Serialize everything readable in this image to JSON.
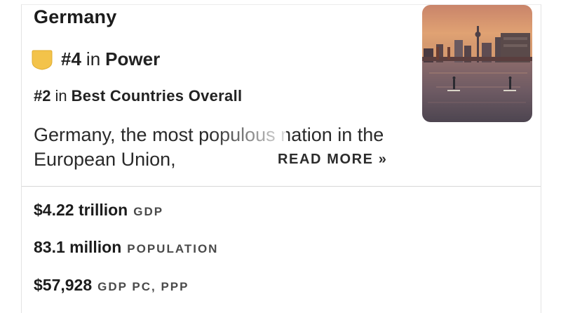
{
  "country": "Germany",
  "rankings": {
    "primary": {
      "rank": "#4",
      "in": "in",
      "category": "Power"
    },
    "secondary": {
      "rank": "#2",
      "in": "in",
      "category": "Best Countries Overall"
    }
  },
  "description": {
    "text": "Germany, the most populous nation in the European Union,",
    "read_more_label": "READ MORE »"
  },
  "stats": [
    {
      "value": "$4.22 trillion",
      "label": "GDP"
    },
    {
      "value": "83.1 million",
      "label": "POPULATION"
    },
    {
      "value": "$57,928",
      "label": "GDP PC, PPP"
    }
  ],
  "colors": {
    "badge": "#f3c34a",
    "divider": "#d7d7d7"
  },
  "icons": {
    "badge": "rank-badge-icon"
  }
}
